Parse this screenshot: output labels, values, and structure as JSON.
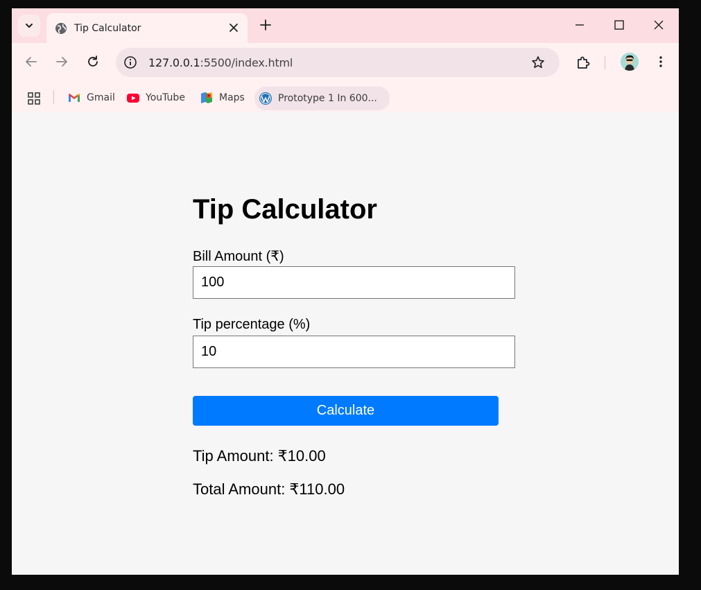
{
  "browser": {
    "tab": {
      "title": "Tip Calculator"
    },
    "address_bar": {
      "url_host": "127.0.0.1",
      "url_rest": ":5500/index.html"
    },
    "bookmarks": [
      {
        "label": "Gmail",
        "icon": "gmail-icon"
      },
      {
        "label": "YouTube",
        "icon": "youtube-icon"
      },
      {
        "label": "Maps",
        "icon": "maps-icon"
      },
      {
        "label": "Prototype 1 In 600...",
        "icon": "wordpress-icon"
      }
    ],
    "colors": {
      "tabstrip": "#fcdde2",
      "toolbar": "#fff1f2",
      "omnibox": "#f1e3e8"
    }
  },
  "page": {
    "title": "Tip Calculator",
    "bill": {
      "label": "Bill Amount (₹)",
      "value": "100"
    },
    "tip": {
      "label": "Tip percentage (%)",
      "value": "10"
    },
    "calculate_label": "Calculate",
    "results": {
      "tip_amount": "Tip Amount: ₹10.00",
      "total_amount": "Total Amount: ₹110.00"
    },
    "colors": {
      "button": "#007bff",
      "background": "#f6f6f6"
    }
  }
}
